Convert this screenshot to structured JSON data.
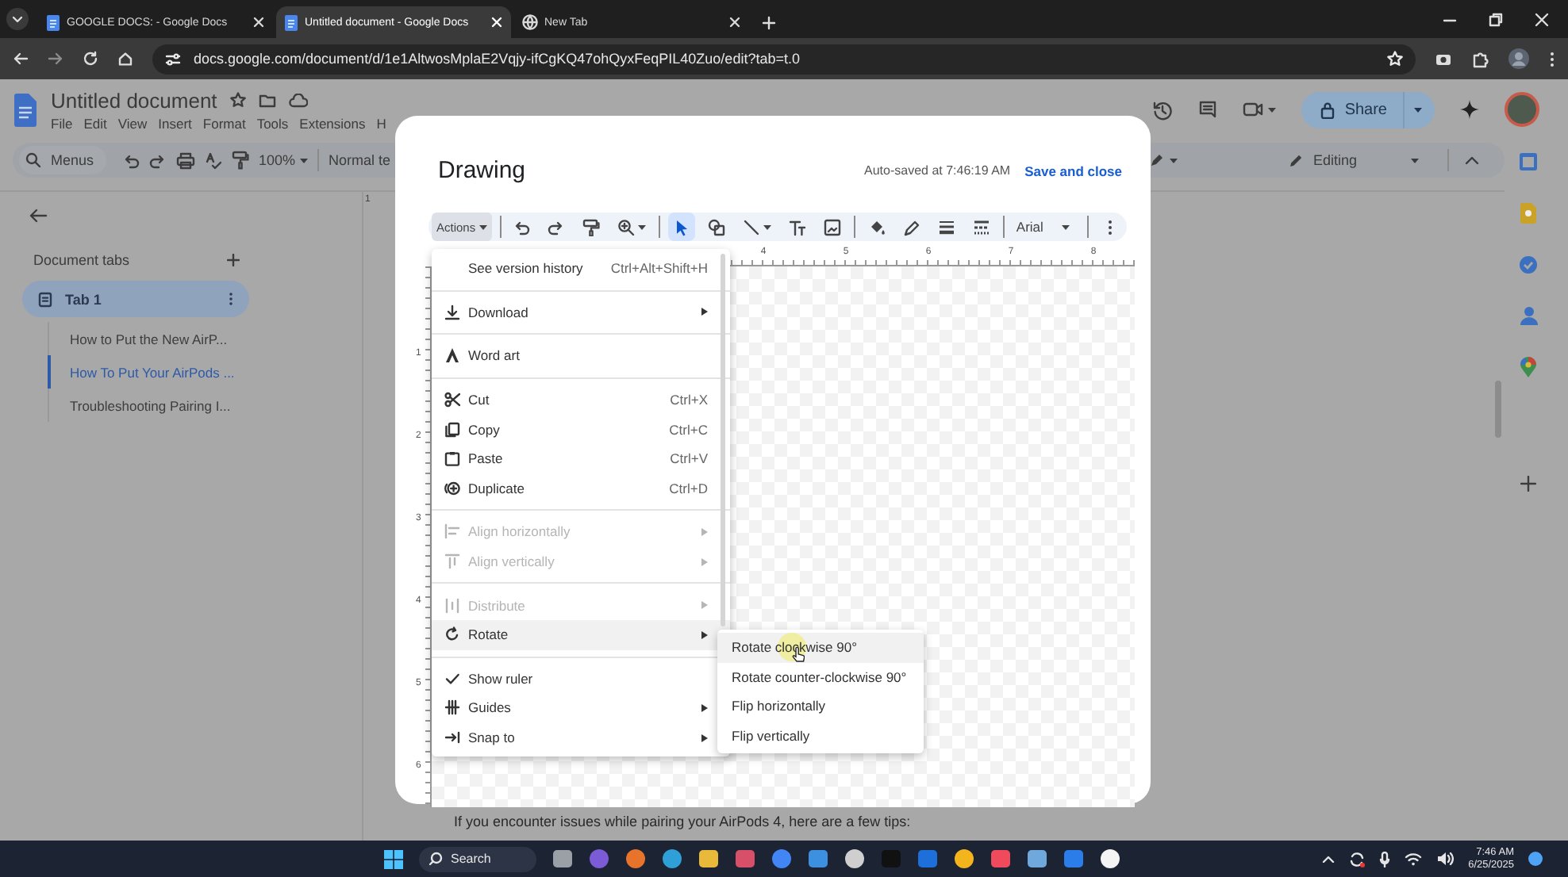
{
  "browser": {
    "tabs": [
      {
        "title": "GOOGLE DOCS: - Google Docs",
        "kind": "docs",
        "selected": false
      },
      {
        "title": "Untitled document - Google Docs",
        "kind": "docs",
        "selected": true
      },
      {
        "title": "New Tab",
        "kind": "newtab",
        "selected": false
      }
    ],
    "url": "docs.google.com/document/d/1e1AltwosMplaE2Vqjy-ifCgKQ47ohQyxFeqPIL40Zuo/edit?tab=t.0"
  },
  "docs": {
    "title": "Untitled document",
    "menus": [
      "File",
      "Edit",
      "View",
      "Insert",
      "Format",
      "Tools",
      "Extensions",
      "H"
    ],
    "search_placeholder": "Menus",
    "zoom": "100%",
    "style": "Normal te",
    "share": "Share",
    "mode": "Editing",
    "ruler_mark": "1",
    "sidebar": {
      "heading": "Document tabs",
      "tabs": [
        {
          "label": "Tab 1",
          "selected": true,
          "children": [
            {
              "label": "How to Put the New AirP...",
              "selected": false
            },
            {
              "label": "How To Put Your AirPods ...",
              "selected": true
            },
            {
              "label": "Troubleshooting Pairing I...",
              "selected": false
            }
          ]
        }
      ]
    },
    "body": "If you encounter issues while pairing your AirPods 4, here are a few tips:"
  },
  "drawing": {
    "title": "Drawing",
    "autosave": "Auto-saved at 7:46:19 AM",
    "save": "Save and close",
    "actions": "Actions",
    "tools": [
      {
        "kind": "undo",
        "selected": false
      },
      {
        "kind": "redo",
        "selected": false
      },
      {
        "kind": "paint",
        "selected": false
      },
      {
        "kind": "zoom",
        "selected": false
      },
      {
        "kind": "select",
        "selected": true
      },
      {
        "kind": "shape",
        "selected": false
      },
      {
        "kind": "line",
        "selected": false
      },
      {
        "kind": "textbox",
        "selected": false
      },
      {
        "kind": "image",
        "selected": false
      },
      {
        "kind": "fill",
        "selected": false
      },
      {
        "kind": "pen",
        "selected": false
      },
      {
        "kind": "weight",
        "selected": false
      },
      {
        "kind": "dash",
        "selected": false
      },
      {
        "kind": "font",
        "label": "Arial",
        "selected": false
      },
      {
        "kind": "more",
        "selected": false
      }
    ],
    "top_ruler": [
      "4",
      "5",
      "6",
      "7",
      "8"
    ],
    "left_ruler": [
      "1",
      "2",
      "3",
      "4",
      "5",
      "6"
    ],
    "menu": [
      [
        {
          "label": "See version history",
          "shortcut": "Ctrl+Alt+Shift+H",
          "kind": "plain",
          "disabled": false,
          "submenu": false,
          "selected": false
        }
      ],
      [
        {
          "label": "Download",
          "kind": "download",
          "disabled": false,
          "submenu": true,
          "selected": false
        }
      ],
      [
        {
          "label": "Word art",
          "kind": "wordart",
          "disabled": false,
          "submenu": false,
          "selected": false
        }
      ],
      [
        {
          "label": "Cut",
          "shortcut": "Ctrl+X",
          "kind": "cut",
          "disabled": false,
          "submenu": false,
          "selected": false
        },
        {
          "label": "Copy",
          "shortcut": "Ctrl+C",
          "kind": "copy",
          "disabled": false,
          "submenu": false,
          "selected": false
        },
        {
          "label": "Paste",
          "shortcut": "Ctrl+V",
          "kind": "paste",
          "disabled": false,
          "submenu": false,
          "selected": false
        },
        {
          "label": "Duplicate",
          "shortcut": "Ctrl+D",
          "kind": "duplicate",
          "disabled": false,
          "submenu": false,
          "selected": false
        }
      ],
      [
        {
          "label": "Align horizontally",
          "kind": "alignh",
          "disabled": true,
          "submenu": true,
          "selected": false
        },
        {
          "label": "Align vertically",
          "kind": "alignv",
          "disabled": true,
          "submenu": true,
          "selected": false
        }
      ],
      [
        {
          "label": "Distribute",
          "kind": "distribute",
          "disabled": true,
          "submenu": true,
          "selected": false
        },
        {
          "label": "Rotate",
          "kind": "rotate",
          "disabled": false,
          "submenu": true,
          "selected": true
        }
      ],
      [
        {
          "label": "Show ruler",
          "kind": "toggle",
          "disabled": false,
          "submenu": false,
          "checked": true,
          "selected": false
        },
        {
          "label": "Guides",
          "kind": "guides",
          "disabled": false,
          "submenu": true,
          "selected": false
        },
        {
          "label": "Snap to",
          "kind": "snap",
          "disabled": false,
          "submenu": true,
          "selected": false
        }
      ]
    ],
    "submenu": [
      {
        "label": "Rotate clockwise 90°",
        "selected": true
      },
      {
        "label": "Rotate counter-clockwise 90°",
        "selected": false
      },
      {
        "label": "Flip horizontally",
        "selected": false
      },
      {
        "label": "Flip vertically",
        "selected": false
      }
    ]
  },
  "taskbar": {
    "search": "Search",
    "time": "7:46 AM",
    "date": "6/25/2025"
  }
}
